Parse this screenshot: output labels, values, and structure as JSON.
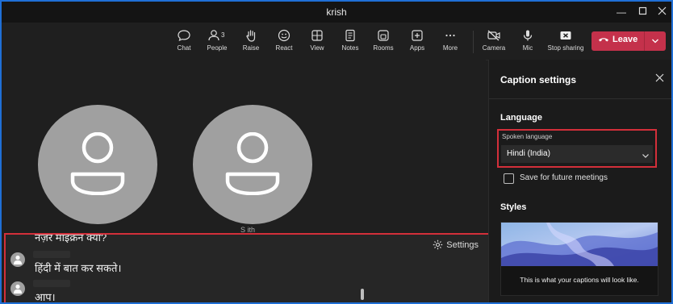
{
  "window": {
    "title": "krish"
  },
  "toolbar": {
    "items": [
      {
        "label": "Chat",
        "icon": "chat-icon"
      },
      {
        "label": "People",
        "icon": "people-icon",
        "count": "3"
      },
      {
        "label": "Raise",
        "icon": "hand-icon"
      },
      {
        "label": "React",
        "icon": "smiley-icon"
      },
      {
        "label": "View",
        "icon": "view-grid-icon"
      },
      {
        "label": "Notes",
        "icon": "notes-icon"
      },
      {
        "label": "Rooms",
        "icon": "rooms-icon"
      },
      {
        "label": "Apps",
        "icon": "apps-plus-icon"
      },
      {
        "label": "More",
        "icon": "more-dots-icon"
      },
      {
        "label": "Camera",
        "icon": "camera-off-icon"
      },
      {
        "label": "Mic",
        "icon": "mic-icon"
      },
      {
        "label": "Stop sharing",
        "icon": "stop-share-icon"
      }
    ],
    "leave_label": "Leave"
  },
  "stage": {
    "participant_fragment": "S     ith"
  },
  "captions": {
    "settings_label": "Settings",
    "lines": [
      {
        "text": "नज़र माईक्रने क्या?"
      },
      {
        "text": "हिंदी में बात कर सकते।"
      },
      {
        "text": "आप।"
      }
    ]
  },
  "pane": {
    "title": "Caption settings",
    "language_heading": "Language",
    "spoken_language_caption": "Spoken language",
    "spoken_language_value": "Hindi (India)",
    "save_future_label": "Save for future meetings",
    "save_future_checked": false,
    "styles_heading": "Styles",
    "preview_text": "This is what your captions will look like."
  },
  "colors": {
    "accent_border": "#1f6fd6",
    "leave": "#c4314b",
    "highlight": "#d32f3a"
  }
}
